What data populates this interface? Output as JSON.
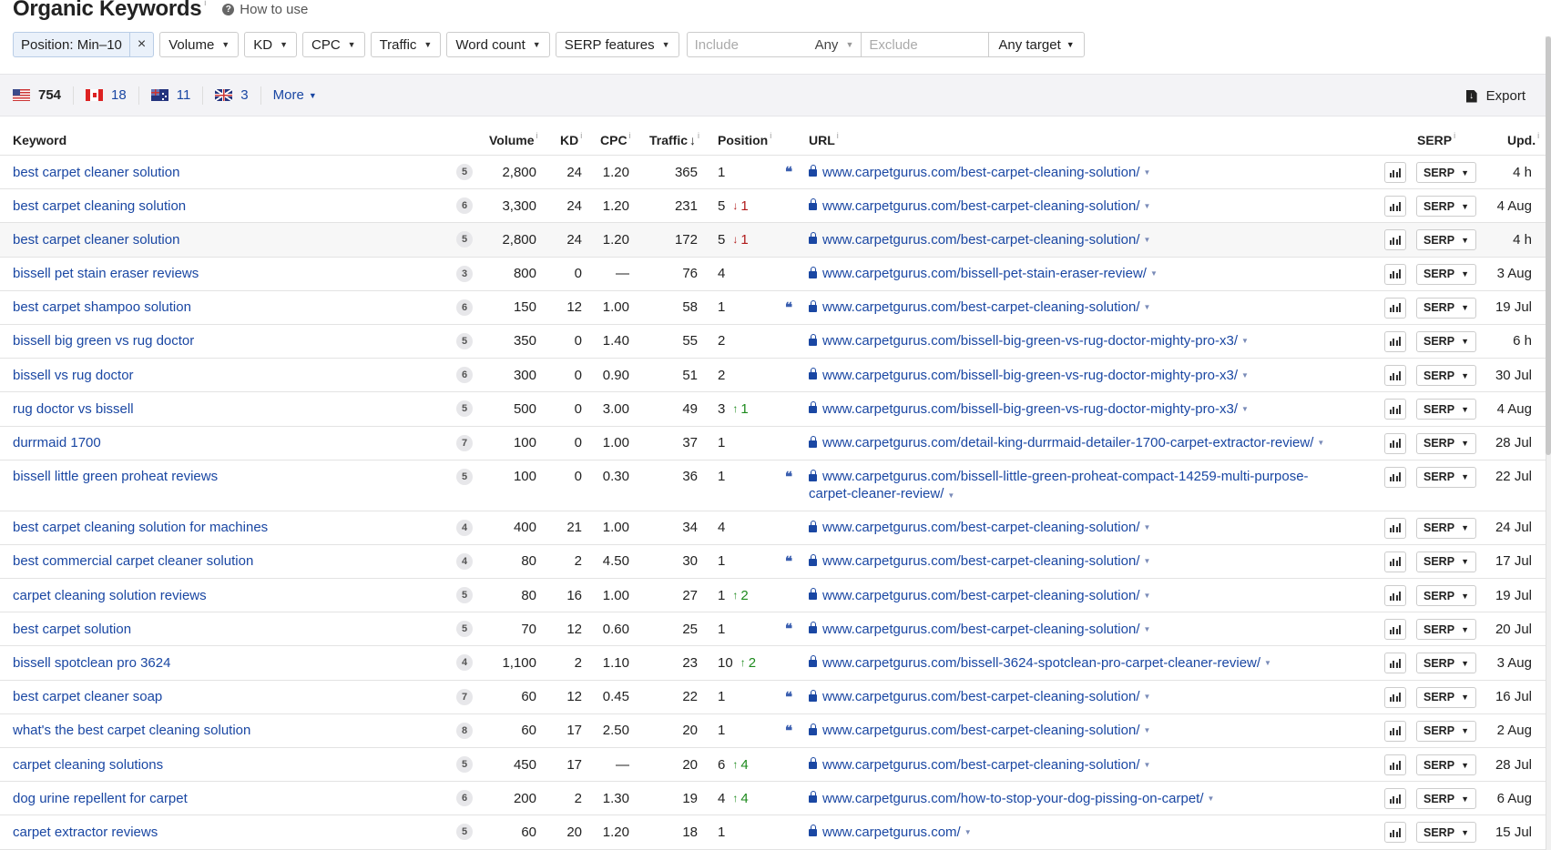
{
  "header": {
    "title": "Organic Keywords",
    "title_info": "i",
    "how_to_use": "How to use",
    "how_to_icon": "?"
  },
  "filters": {
    "position": {
      "label": "Position: Min–10",
      "clear": "×"
    },
    "buttons": [
      {
        "label": "Volume"
      },
      {
        "label": "KD"
      },
      {
        "label": "CPC"
      },
      {
        "label": "Traffic"
      },
      {
        "label": "Word count"
      },
      {
        "label": "SERP features"
      }
    ],
    "include_placeholder": "Include",
    "include_mode": "Any",
    "exclude_placeholder": "Exclude",
    "target": "Any target",
    "caret": "▼"
  },
  "countries": [
    {
      "flag": "us-flag-icon",
      "count": "754"
    },
    {
      "flag": "ca-flag-icon",
      "count": "18"
    },
    {
      "flag": "au-flag-icon",
      "count": "11"
    },
    {
      "flag": "gb-flag-icon",
      "count": "3"
    }
  ],
  "more_label": "More",
  "export_label": "Export",
  "columns": {
    "keyword": "Keyword",
    "volume": "Volume",
    "kd": "KD",
    "cpc": "CPC",
    "traffic": "Traffic",
    "traffic_sort": "↓",
    "position": "Position",
    "url": "URL",
    "serp": "SERP",
    "updated": "Upd.",
    "info": "i"
  },
  "serp_button_label": "SERP",
  "rows": [
    {
      "keyword": "best carpet cleaner solution",
      "words": "5",
      "volume": "2,800",
      "kd": "24",
      "cpc": "1.20",
      "traffic": "365",
      "position": "1",
      "delta": "",
      "delta_dir": "",
      "snippet": true,
      "url": "www.carpetgurus.com/best-carpet-cleaning-solution/",
      "updated": "4 h"
    },
    {
      "keyword": "best carpet cleaning solution",
      "words": "6",
      "volume": "3,300",
      "kd": "24",
      "cpc": "1.20",
      "traffic": "231",
      "position": "5",
      "delta": "1",
      "delta_dir": "down",
      "snippet": false,
      "url": "www.carpetgurus.com/best-carpet-cleaning-solution/",
      "updated": "4 Aug"
    },
    {
      "keyword": "best carpet cleaner solution",
      "words": "5",
      "volume": "2,800",
      "kd": "24",
      "cpc": "1.20",
      "traffic": "172",
      "position": "5",
      "delta": "1",
      "delta_dir": "down",
      "snippet": false,
      "url": "www.carpetgurus.com/best-carpet-cleaning-solution/",
      "updated": "4 h",
      "highlighted": true
    },
    {
      "keyword": "bissell pet stain eraser reviews",
      "words": "3",
      "volume": "800",
      "kd": "0",
      "cpc": "—",
      "traffic": "76",
      "position": "4",
      "delta": "",
      "delta_dir": "",
      "snippet": false,
      "url": "www.carpetgurus.com/bissell-pet-stain-eraser-review/",
      "updated": "3 Aug"
    },
    {
      "keyword": "best carpet shampoo solution",
      "words": "6",
      "volume": "150",
      "kd": "12",
      "cpc": "1.00",
      "traffic": "58",
      "position": "1",
      "delta": "",
      "delta_dir": "",
      "snippet": true,
      "url": "www.carpetgurus.com/best-carpet-cleaning-solution/",
      "updated": "19 Jul"
    },
    {
      "keyword": "bissell big green vs rug doctor",
      "words": "5",
      "volume": "350",
      "kd": "0",
      "cpc": "1.40",
      "traffic": "55",
      "position": "2",
      "delta": "",
      "delta_dir": "",
      "snippet": false,
      "url": "www.carpetgurus.com/bissell-big-green-vs-rug-doctor-mighty-pro-x3/",
      "updated": "6 h"
    },
    {
      "keyword": "bissell vs rug doctor",
      "words": "6",
      "volume": "300",
      "kd": "0",
      "cpc": "0.90",
      "traffic": "51",
      "position": "2",
      "delta": "",
      "delta_dir": "",
      "snippet": false,
      "url": "www.carpetgurus.com/bissell-big-green-vs-rug-doctor-mighty-pro-x3/",
      "updated": "30 Jul"
    },
    {
      "keyword": "rug doctor vs bissell",
      "words": "5",
      "volume": "500",
      "kd": "0",
      "cpc": "3.00",
      "traffic": "49",
      "position": "3",
      "delta": "1",
      "delta_dir": "up",
      "snippet": false,
      "url": "www.carpetgurus.com/bissell-big-green-vs-rug-doctor-mighty-pro-x3/",
      "updated": "4 Aug"
    },
    {
      "keyword": "durrmaid 1700",
      "words": "7",
      "volume": "100",
      "kd": "0",
      "cpc": "1.00",
      "traffic": "37",
      "position": "1",
      "delta": "",
      "delta_dir": "",
      "snippet": false,
      "url": "www.carpetgurus.com/detail-king-durrmaid-detailer-1700-carpet-extractor-review/",
      "updated": "28 Jul"
    },
    {
      "keyword": "bissell little green proheat reviews",
      "words": "5",
      "volume": "100",
      "kd": "0",
      "cpc": "0.30",
      "traffic": "36",
      "position": "1",
      "delta": "",
      "delta_dir": "",
      "snippet": true,
      "url": "www.carpetgurus.com/bissell-little-green-proheat-compact-14259-multi-purpose-carpet-cleaner-review/",
      "updated": "22 Jul",
      "tall": true
    },
    {
      "keyword": "best carpet cleaning solution for machines",
      "words": "4",
      "volume": "400",
      "kd": "21",
      "cpc": "1.00",
      "traffic": "34",
      "position": "4",
      "delta": "",
      "delta_dir": "",
      "snippet": false,
      "url": "www.carpetgurus.com/best-carpet-cleaning-solution/",
      "updated": "24 Jul"
    },
    {
      "keyword": "best commercial carpet cleaner solution",
      "words": "4",
      "volume": "80",
      "kd": "2",
      "cpc": "4.50",
      "traffic": "30",
      "position": "1",
      "delta": "",
      "delta_dir": "",
      "snippet": true,
      "url": "www.carpetgurus.com/best-carpet-cleaning-solution/",
      "updated": "17 Jul"
    },
    {
      "keyword": "carpet cleaning solution reviews",
      "words": "5",
      "volume": "80",
      "kd": "16",
      "cpc": "1.00",
      "traffic": "27",
      "position": "1",
      "delta": "2",
      "delta_dir": "up",
      "snippet": false,
      "url": "www.carpetgurus.com/best-carpet-cleaning-solution/",
      "updated": "19 Jul"
    },
    {
      "keyword": "best carpet solution",
      "words": "5",
      "volume": "70",
      "kd": "12",
      "cpc": "0.60",
      "traffic": "25",
      "position": "1",
      "delta": "",
      "delta_dir": "",
      "snippet": true,
      "url": "www.carpetgurus.com/best-carpet-cleaning-solution/",
      "updated": "20 Jul"
    },
    {
      "keyword": "bissell spotclean pro 3624",
      "words": "4",
      "volume": "1,100",
      "kd": "2",
      "cpc": "1.10",
      "traffic": "23",
      "position": "10",
      "delta": "2",
      "delta_dir": "up",
      "snippet": false,
      "url": "www.carpetgurus.com/bissell-3624-spotclean-pro-carpet-cleaner-review/",
      "updated": "3 Aug"
    },
    {
      "keyword": "best carpet cleaner soap",
      "words": "7",
      "volume": "60",
      "kd": "12",
      "cpc": "0.45",
      "traffic": "22",
      "position": "1",
      "delta": "",
      "delta_dir": "",
      "snippet": true,
      "url": "www.carpetgurus.com/best-carpet-cleaning-solution/",
      "updated": "16 Jul"
    },
    {
      "keyword": "what's the best carpet cleaning solution",
      "words": "8",
      "volume": "60",
      "kd": "17",
      "cpc": "2.50",
      "traffic": "20",
      "position": "1",
      "delta": "",
      "delta_dir": "",
      "snippet": true,
      "url": "www.carpetgurus.com/best-carpet-cleaning-solution/",
      "updated": "2 Aug"
    },
    {
      "keyword": "carpet cleaning solutions",
      "words": "5",
      "volume": "450",
      "kd": "17",
      "cpc": "—",
      "traffic": "20",
      "position": "6",
      "delta": "4",
      "delta_dir": "up",
      "snippet": false,
      "url": "www.carpetgurus.com/best-carpet-cleaning-solution/",
      "updated": "28 Jul"
    },
    {
      "keyword": "dog urine repellent for carpet",
      "words": "6",
      "volume": "200",
      "kd": "2",
      "cpc": "1.30",
      "traffic": "19",
      "position": "4",
      "delta": "4",
      "delta_dir": "up",
      "snippet": false,
      "url": "www.carpetgurus.com/how-to-stop-your-dog-pissing-on-carpet/",
      "updated": "6 Aug"
    },
    {
      "keyword": "carpet extractor reviews",
      "words": "5",
      "volume": "60",
      "kd": "20",
      "cpc": "1.20",
      "traffic": "18",
      "position": "1",
      "delta": "",
      "delta_dir": "",
      "snippet": false,
      "url": "www.carpetgurus.com/",
      "updated": "15 Jul"
    }
  ],
  "colors": {
    "link": "#1a47a3",
    "down": "#b01a1a",
    "up": "#1d8a1d",
    "filter_active_bg": "#eaf1fa",
    "country_bar_bg": "#f3f3f6"
  }
}
